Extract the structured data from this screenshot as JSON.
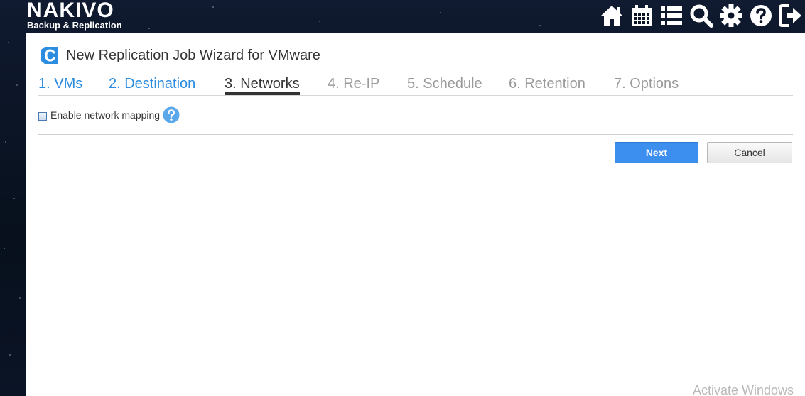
{
  "app": {
    "logo_main": "NAKIVO",
    "logo_sub": "Backup & Replication"
  },
  "toolbar": {
    "icons": [
      "home-icon",
      "calendar-icon",
      "list-icon",
      "search-icon",
      "gear-icon",
      "help-icon",
      "logout-icon"
    ]
  },
  "wizard": {
    "title": "New Replication Job Wizard for VMware",
    "steps": [
      {
        "label": "1. VMs",
        "state": "done"
      },
      {
        "label": "2. Destination",
        "state": "done"
      },
      {
        "label": "3. Networks",
        "state": "active"
      },
      {
        "label": "4. Re-IP",
        "state": "future"
      },
      {
        "label": "5. Schedule",
        "state": "future"
      },
      {
        "label": "6. Retention",
        "state": "future"
      },
      {
        "label": "7. Options",
        "state": "future"
      }
    ],
    "option_label": "Enable network mapping",
    "option_checked": false,
    "next_label": "Next",
    "cancel_label": "Cancel"
  },
  "watermark": "Activate Windows",
  "colors": {
    "accent": "#2b8ce0",
    "next_button": "#3c8fef",
    "inactive_step": "#9a9a9a"
  }
}
